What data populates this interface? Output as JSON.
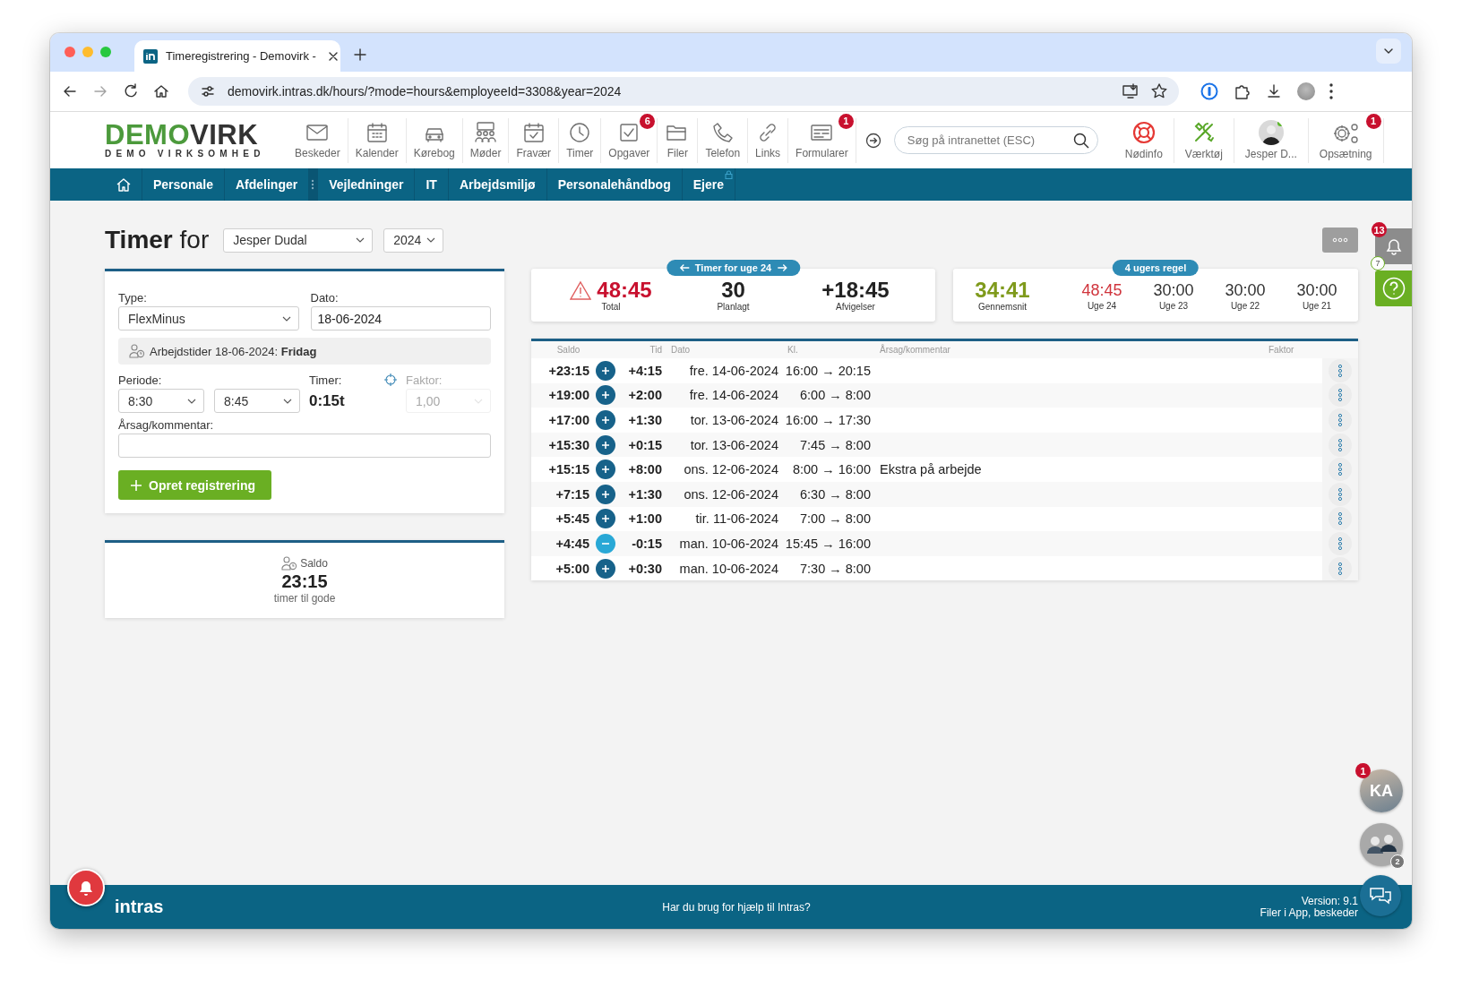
{
  "browser": {
    "tab_title": "Timeregistrering - Demovirk -",
    "url": "demovirk.intras.dk/hours/?mode=hours&employeeId=3308&year=2024"
  },
  "header": {
    "logo": {
      "brand_green": "DEMO",
      "brand_dark": "VIRK",
      "tagline": "DEMO VIRKSOMHED"
    },
    "apps": [
      {
        "label": "Beskeder"
      },
      {
        "label": "Kalender"
      },
      {
        "label": "Kørebog"
      },
      {
        "label": "Møder"
      },
      {
        "label": "Fravær"
      },
      {
        "label": "Timer"
      },
      {
        "label": "Opgaver",
        "badge": "6"
      },
      {
        "label": "Filer"
      },
      {
        "label": "Telefon"
      },
      {
        "label": "Links"
      },
      {
        "label": "Formularer",
        "badge": "1"
      }
    ],
    "search": {
      "placeholder": "Søg på intranettet (ESC)"
    },
    "tools": [
      {
        "label": "Nødinfo"
      },
      {
        "label": "Værktøj"
      },
      {
        "label": "Jesper D...",
        "online": true
      },
      {
        "label": "Opsætning",
        "badge": "1"
      }
    ]
  },
  "nav": {
    "items": [
      {
        "label": "Personale",
        "locked": false,
        "handle": false
      },
      {
        "label": "Afdelinger",
        "locked": false,
        "handle": true
      },
      {
        "label": "Vejledninger",
        "locked": false,
        "handle": false
      },
      {
        "label": "IT",
        "locked": false,
        "handle": false
      },
      {
        "label": "Arbejdsmiljø",
        "locked": false,
        "handle": false
      },
      {
        "label": "Personalehåndbog",
        "locked": false,
        "handle": false
      },
      {
        "label": "Ejere",
        "locked": true,
        "handle": false
      }
    ]
  },
  "page": {
    "title": "**Timer** for",
    "employee": "Jesper Dudal",
    "year": "2024"
  },
  "form": {
    "type_label": "Type:",
    "type_value": "FlexMinus",
    "date_label": "Dato:",
    "date_value": "18-06-2024",
    "schedule_note": "Arbejdstider 18-06-2024: **Fridag**",
    "period_label": "Periode:",
    "period_from": "8:30",
    "period_to": "8:45",
    "hours_label": "Timer:",
    "hours_value": "0:15t",
    "factor_label": "Faktor:",
    "factor_value": "1,00",
    "factor_disabled": true,
    "comment_label": "Årsag/kommentar:",
    "submit": "Opret registrering"
  },
  "saldo": {
    "label": "Saldo",
    "value": "23:15",
    "caption": "timer til gode"
  },
  "week": {
    "pill": "Timer for uge 24",
    "stats": [
      {
        "value": "48:45",
        "label": "Total",
        "warning": true
      },
      {
        "value": "30",
        "label": "Planlagt",
        "warning": false
      },
      {
        "value": "+18:45",
        "label": "Afvigelser",
        "warning": false
      }
    ]
  },
  "rule": {
    "pill": "4 ugers regel",
    "average": {
      "value": "34:41",
      "label": "Gennemsnit"
    },
    "weeks": [
      {
        "value": "48:45",
        "label": "Uge 24",
        "exceeded": true
      },
      {
        "value": "30:00",
        "label": "Uge 23",
        "exceeded": false
      },
      {
        "value": "30:00",
        "label": "Uge 22",
        "exceeded": false
      },
      {
        "value": "30:00",
        "label": "Uge 21",
        "exceeded": false
      }
    ]
  },
  "table": {
    "columns": [
      "Saldo",
      "Tid",
      "Dato",
      "Kl.",
      "Årsag/kommentar",
      "Faktor"
    ],
    "rows": [
      {
        "saldo": "+23:15",
        "kind": "plus",
        "tid": "+4:15",
        "dato": "fre. 14-06-2024",
        "kl": "16:00 → 20:15"
      },
      {
        "saldo": "+19:00",
        "kind": "plus",
        "tid": "+2:00",
        "dato": "fre. 14-06-2024",
        "kl": "6:00 → 8:00"
      },
      {
        "saldo": "+17:00",
        "kind": "plus",
        "tid": "+1:30",
        "dato": "tor. 13-06-2024",
        "kl": "16:00 → 17:30"
      },
      {
        "saldo": "+15:30",
        "kind": "plus",
        "tid": "+0:15",
        "dato": "tor. 13-06-2024",
        "kl": "7:45 → 8:00"
      },
      {
        "saldo": "+15:15",
        "kind": "plus",
        "tid": "+8:00",
        "dato": "ons. 12-06-2024",
        "kl": "8:00 → 16:00",
        "comment": "Ekstra på arbejde"
      },
      {
        "saldo": "+7:15",
        "kind": "plus",
        "tid": "+1:30",
        "dato": "ons. 12-06-2024",
        "kl": "6:30 → 8:00"
      },
      {
        "saldo": "+5:45",
        "kind": "plus",
        "tid": "+1:00",
        "dato": "tir. 11-06-2024",
        "kl": "7:00 → 8:00"
      },
      {
        "saldo": "+4:45",
        "kind": "minus",
        "tid": "-0:15",
        "dato": "man. 10-06-2024",
        "kl": "15:45 → 16:00"
      },
      {
        "saldo": "+5:00",
        "kind": "plus",
        "tid": "+0:30",
        "dato": "man. 10-06-2024",
        "kl": "7:30 → 8:00"
      }
    ]
  },
  "widgets": {
    "notifications_badge": "13",
    "help_badge": "7",
    "chat_avatar": {
      "initials": "KA",
      "badge": "1"
    },
    "group_badge": "2"
  },
  "footer": {
    "logo": "intras",
    "help": "Har du brug for hjælp til Intras?",
    "version": "Version: 9.1",
    "note": "Filer i App, beskeder"
  }
}
